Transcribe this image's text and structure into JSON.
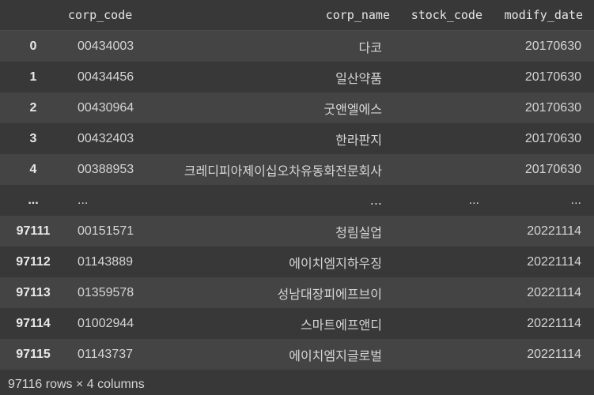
{
  "dataframe": {
    "columns": [
      "corp_code",
      "corp_name",
      "stock_code",
      "modify_date"
    ],
    "rows": [
      {
        "index": "0",
        "corp_code": "00434003",
        "corp_name": "다코",
        "stock_code": "",
        "modify_date": "20170630"
      },
      {
        "index": "1",
        "corp_code": "00434456",
        "corp_name": "일산약품",
        "stock_code": "",
        "modify_date": "20170630"
      },
      {
        "index": "2",
        "corp_code": "00430964",
        "corp_name": "굿앤엘에스",
        "stock_code": "",
        "modify_date": "20170630"
      },
      {
        "index": "3",
        "corp_code": "00432403",
        "corp_name": "한라판지",
        "stock_code": "",
        "modify_date": "20170630"
      },
      {
        "index": "4",
        "corp_code": "00388953",
        "corp_name": "크레디피아제이십오차유동화전문회사",
        "stock_code": "",
        "modify_date": "20170630"
      },
      {
        "index": "...",
        "corp_code": "...",
        "corp_name": "...",
        "stock_code": "...",
        "modify_date": "..."
      },
      {
        "index": "97111",
        "corp_code": "00151571",
        "corp_name": "청림실업",
        "stock_code": "",
        "modify_date": "20221114"
      },
      {
        "index": "97112",
        "corp_code": "01143889",
        "corp_name": "에이치엠지하우징",
        "stock_code": "",
        "modify_date": "20221114"
      },
      {
        "index": "97113",
        "corp_code": "01359578",
        "corp_name": "성남대장피에프브이",
        "stock_code": "",
        "modify_date": "20221114"
      },
      {
        "index": "97114",
        "corp_code": "01002944",
        "corp_name": "스마트에프앤디",
        "stock_code": "",
        "modify_date": "20221114"
      },
      {
        "index": "97115",
        "corp_code": "01143737",
        "corp_name": "에이치엠지글로벌",
        "stock_code": "",
        "modify_date": "20221114"
      }
    ],
    "footer": "97116 rows × 4 columns"
  }
}
